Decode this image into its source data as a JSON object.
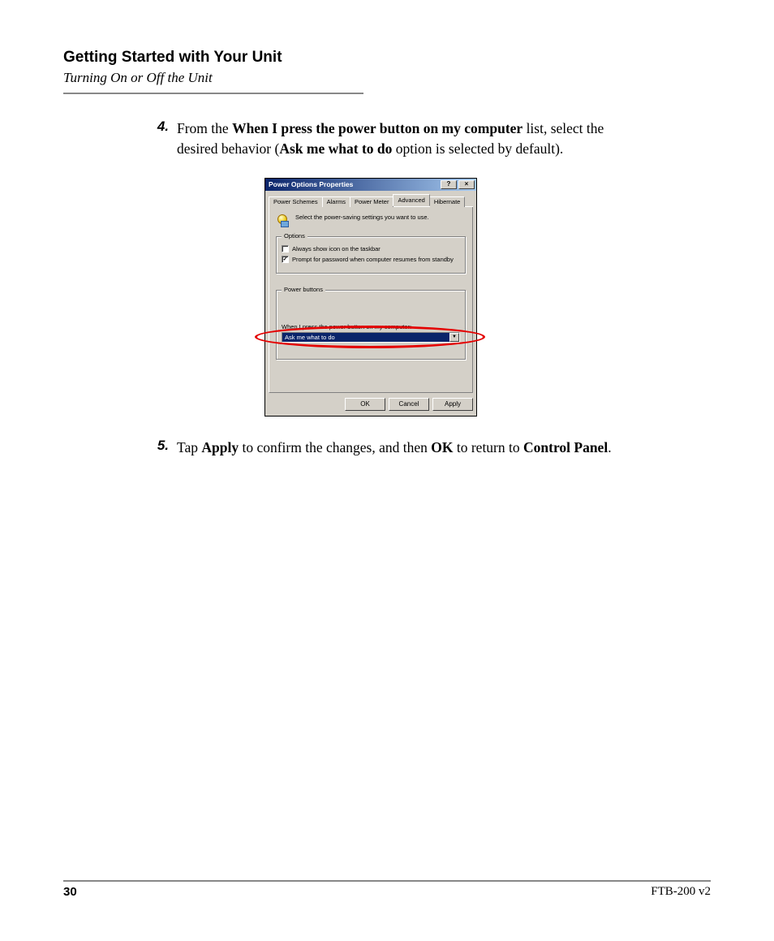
{
  "header": {
    "chapter": "Getting Started with Your Unit",
    "section": "Turning On or Off the Unit"
  },
  "steps": {
    "s4": {
      "num": "4.",
      "t1": "From the ",
      "b1": "When I press the power button on my computer",
      "t2": " list, select the desired behavior (",
      "b2": "Ask me what to do",
      "t3": " option is selected by default)."
    },
    "s5": {
      "num": "5.",
      "t1": "Tap ",
      "b1": "Apply",
      "t2": " to confirm the changes, and then ",
      "b2": "OK",
      "t3": " to return to ",
      "b3": "Control Panel",
      "t4": "."
    }
  },
  "dialog": {
    "title": "Power Options Properties",
    "help_glyph": "?",
    "close_glyph": "×",
    "tabs": {
      "schemes": "Power Schemes",
      "alarms": "Alarms",
      "meter": "Power Meter",
      "advanced": "Advanced",
      "hibernate": "Hibernate"
    },
    "info": "Select the power-saving settings you want to use.",
    "options_legend": "Options",
    "opt_icon": "Always show icon on the taskbar",
    "opt_prompt": "Prompt for password when computer resumes from standby",
    "power_legend": "Power buttons",
    "combo_label": "When I press the power button on my computer:",
    "combo_value": "Ask me what to do",
    "combo_arrow": "▼",
    "buttons": {
      "ok": "OK",
      "cancel": "Cancel",
      "apply": "Apply"
    }
  },
  "footer": {
    "page": "30",
    "doc": "FTB-200 v2"
  }
}
